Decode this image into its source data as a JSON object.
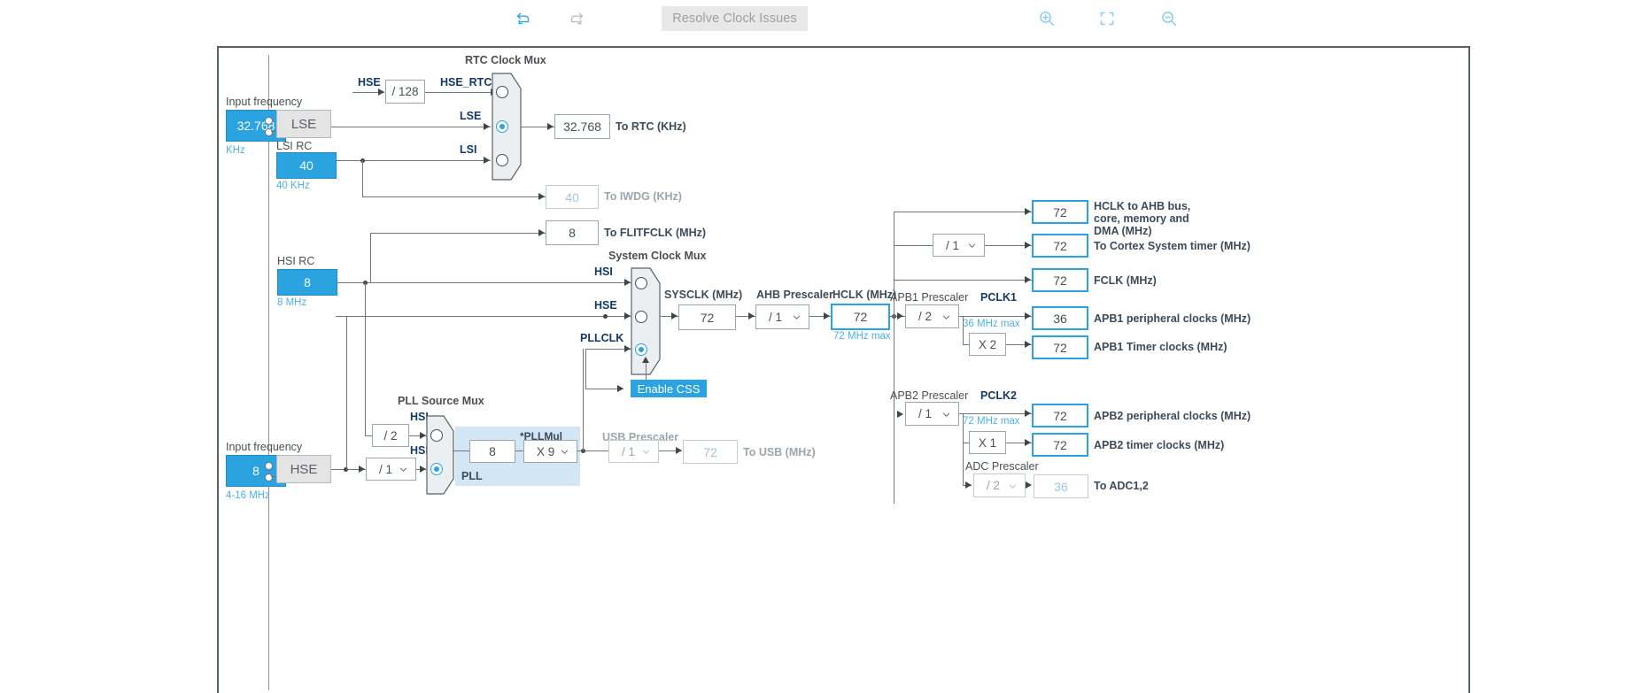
{
  "toolbar": {
    "undo": {
      "name": "undo",
      "icon": "undo-icon"
    },
    "redo": {
      "name": "redo",
      "icon": "redo-icon"
    },
    "reset": {
      "name": "reset",
      "icon": "reset-icon"
    },
    "resolve_label": "Resolve Clock Issues",
    "zoom_in": {
      "icon": "zoom-in-icon"
    },
    "fit": {
      "icon": "fit-to-screen-icon"
    },
    "zoom_out": {
      "icon": "zoom-out-icon"
    }
  },
  "colors": {
    "accent": "#2aa3e0",
    "source_fill": "#2aa3e0",
    "highlight_border": "#2aa3e0",
    "pll_group": "#d3e6f5",
    "osc_fill": "#e4e4e4",
    "wire": "#6f767c",
    "label": "#4a4f54",
    "signal_label": "#123a66",
    "note": "#4db2e8",
    "disabled": "#9aa5ad"
  },
  "lse": {
    "input_frequency_label": "Input frequency",
    "input_frequency_value": "32.768",
    "unit_note": "KHz",
    "osc_label": "LSE"
  },
  "lsi": {
    "title": "LSI RC",
    "value": "40",
    "note": "40 KHz"
  },
  "hse_rtc": {
    "hse_label": "HSE",
    "divider_label": "/ 128",
    "out_label": "HSE_RTC"
  },
  "rtc_mux": {
    "title": "RTC Clock Mux",
    "inputs": [
      {
        "label": "HSE_RTC",
        "selected": false
      },
      {
        "label": "LSE",
        "selected": true
      },
      {
        "label": "LSI",
        "selected": false
      }
    ],
    "out_value": "32.768",
    "out_label": "To RTC (KHz)"
  },
  "iwdg": {
    "value": "40",
    "label": "To IWDG (KHz)"
  },
  "flitfclk": {
    "value": "8",
    "label": "To FLITFCLK (MHz)"
  },
  "hsi": {
    "title": "HSI RC",
    "value": "8",
    "note": "8 MHz"
  },
  "hse": {
    "input_frequency_label": "Input frequency",
    "input_frequency_value": "8",
    "note": "4-16 MHz",
    "osc_label": "HSE",
    "prescaler": "/ 1"
  },
  "sys_mux": {
    "title": "System Clock Mux",
    "inputs": [
      {
        "label": "HSI",
        "selected": false
      },
      {
        "label": "HSE",
        "selected": false
      },
      {
        "label": "PLLCLK",
        "selected": true
      }
    ]
  },
  "css": {
    "label": "Enable CSS"
  },
  "pll_source_mux": {
    "title": "PLL Source Mux",
    "hsi_divider": "/ 2",
    "inputs": [
      {
        "label": "HSI",
        "selected": false
      },
      {
        "label": "HSE",
        "selected": true
      }
    ]
  },
  "pll": {
    "group_label": "PLL",
    "input_value": "8",
    "mul_label": "*PLLMul",
    "mul_value": "X 9"
  },
  "usb": {
    "prescaler_title": "USB Prescaler",
    "prescaler_value": "/ 1",
    "out_value": "72",
    "out_label": "To USB (MHz)"
  },
  "sysclk": {
    "title": "SYSCLK (MHz)",
    "value": "72"
  },
  "ahb": {
    "title": "AHB Prescaler",
    "value": "/ 1"
  },
  "hclk": {
    "title": "HCLK (MHz)",
    "value": "72",
    "note": "72 MHz max"
  },
  "outputs": [
    {
      "value": "72",
      "label": "HCLK to AHB bus, core, memory and DMA (MHz)"
    },
    {
      "value": "72",
      "label": "To Cortex System timer (MHz)"
    },
    {
      "value": "72",
      "label": "FCLK (MHz)"
    }
  ],
  "cortex_prescaler": {
    "value": "/ 1"
  },
  "apb1": {
    "prescaler_title": "APB1 Prescaler",
    "prescaler_value": "/ 2",
    "pclk_label": "PCLK1",
    "max_note": "36 MHz max",
    "peripheral_value": "36",
    "peripheral_label": "APB1 peripheral clocks (MHz)",
    "timer_mul": "X 2",
    "timer_value": "72",
    "timer_label": "APB1 Timer clocks (MHz)"
  },
  "apb2": {
    "prescaler_title": "APB2 Prescaler",
    "prescaler_value": "/ 1",
    "pclk_label": "PCLK2",
    "max_note": "72 MHz max",
    "peripheral_value": "72",
    "peripheral_label": "APB2 peripheral clocks (MHz)",
    "timer_mul": "X 1",
    "timer_value": "72",
    "timer_label": "APB2 timer clocks (MHz)"
  },
  "adc": {
    "prescaler_title": "ADC Prescaler",
    "prescaler_value": "/ 2",
    "value": "36",
    "label": "To ADC1,2"
  }
}
